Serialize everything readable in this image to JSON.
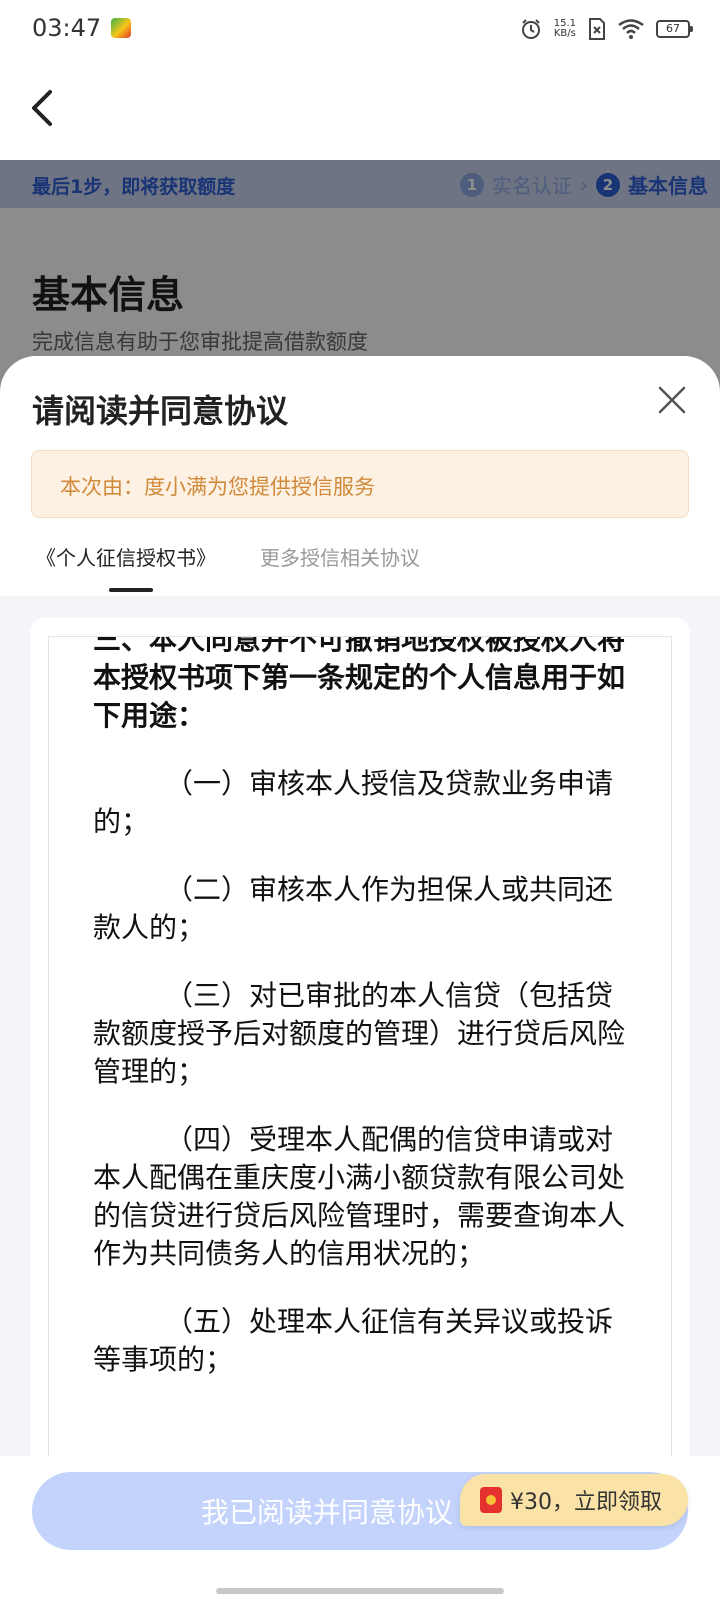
{
  "status_bar": {
    "time": "03:47",
    "net_speed_value": "15.1",
    "net_speed_unit": "KB/s",
    "battery": "67"
  },
  "progress": {
    "hint": "最后1步，即将获取额度",
    "steps": [
      {
        "num": "1",
        "label": "实名认证"
      },
      {
        "num": "2",
        "label": "基本信息"
      }
    ]
  },
  "page": {
    "title": "基本信息",
    "subtitle": "完成信息有助于您审批提高借款额度"
  },
  "sheet": {
    "title": "请阅读并同意协议",
    "provider_notice": "本次由：度小满为您提供授信服务",
    "tabs": [
      {
        "label": "《个人征信授权书》"
      },
      {
        "label": "更多授信相关协议"
      }
    ],
    "document": {
      "heading": "三、本人同意并不可撤销地授权被授权人将本授权书项下第一条规定的个人信息用于如下用途：",
      "paragraphs": [
        "（一）审核本人授信及贷款业务申请的；",
        "（二）审核本人作为担保人或共同还款人的；",
        "（三）对已审批的本人信贷（包括贷款额度授予后对额度的管理）进行贷后风险管理的；",
        "（四）受理本人配偶的信贷申请或对本人配偶在重庆度小满小额贷款有限公司处的信贷进行贷后风险管理时，需要查询本人作为共同债务人的信用状况的；",
        "（五）处理本人征信有关异议或投诉等事项的；"
      ]
    },
    "agree_button": "我已阅读并同意协议 (1S)",
    "promo": "¥30，立即领取"
  },
  "colors": {
    "primary": "#2f5fd6",
    "button_disabled": "#c3d3fb",
    "notice_text": "#d08a3a"
  }
}
